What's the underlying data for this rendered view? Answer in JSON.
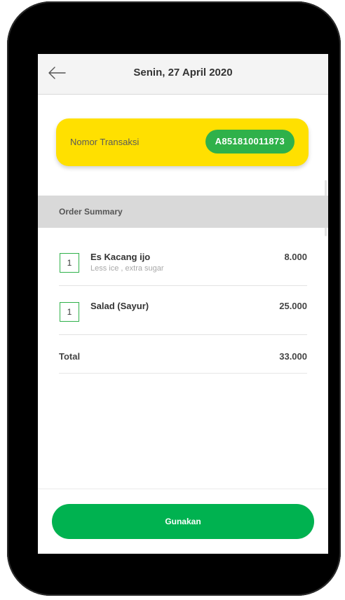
{
  "header": {
    "title": "Senin, 27 April 2020",
    "back_icon": "arrow-left-icon"
  },
  "transaction": {
    "label": "Nomor Transaksi",
    "number": "A851810011873"
  },
  "order_summary": {
    "title": "Order Summary",
    "items": [
      {
        "qty": "1",
        "name": "Es Kacang ijo",
        "note": "Less ice , extra sugar",
        "price": "8.000"
      },
      {
        "qty": "1",
        "name": "Salad (Sayur)",
        "note": "",
        "price": "25.000"
      }
    ],
    "total_label": "Total",
    "total_value": "33.000"
  },
  "actions": {
    "primary_label": "Gunakan"
  },
  "colors": {
    "accent_yellow": "#ffe000",
    "badge_green": "#2fb14a",
    "button_green": "#00b250"
  }
}
